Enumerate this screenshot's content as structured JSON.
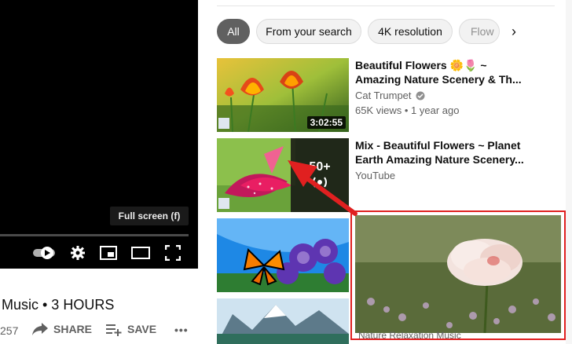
{
  "player": {
    "tooltip": "Full screen (f)"
  },
  "below": {
    "title": "Music • 3 HOURS",
    "count": "257",
    "share": "SHARE",
    "save": "SAVE",
    "more": "•••"
  },
  "chips": [
    {
      "label": "All",
      "active": true
    },
    {
      "label": "From your search",
      "active": false
    },
    {
      "label": "4K resolution",
      "active": false
    },
    {
      "label": "Flow",
      "active": false
    }
  ],
  "videos": [
    {
      "title_line1": "Beautiful Flowers 🌼🌷 ~",
      "title_line2": "Amazing Nature Scenery & Th...",
      "channel": "Cat Trumpet",
      "stats": "65K views • 1 year ago",
      "duration": "3:02:55"
    },
    {
      "title_line1": "Mix - Beautiful Flowers ~ Planet",
      "title_line2": "Earth Amazing Nature Scenery...",
      "channel": "YouTube",
      "mix_count": "50+"
    }
  ],
  "preview": {
    "caption": "Nature Relaxation Music"
  },
  "colors": {
    "highlight": "#e02020",
    "chip_active": "#606060",
    "chip": "#f2f2f2"
  }
}
